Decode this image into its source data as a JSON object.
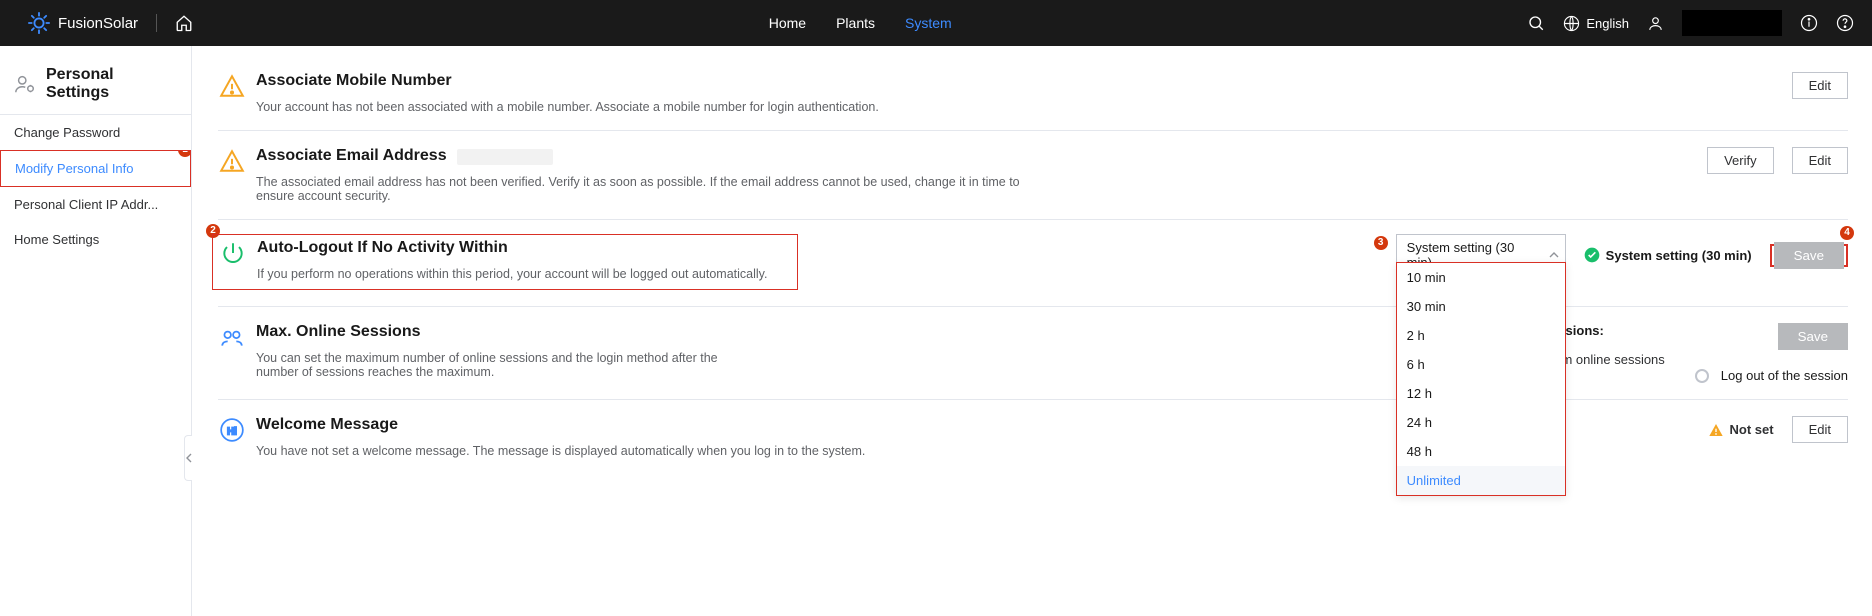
{
  "header": {
    "brand": "FusionSolar",
    "nav": {
      "home": "Home",
      "plants": "Plants",
      "system": "System"
    },
    "language": "English"
  },
  "sidebar": {
    "title": "Personal Settings",
    "items": [
      {
        "label": "Change Password"
      },
      {
        "label": "Modify Personal Info"
      },
      {
        "label": "Personal Client IP Addr..."
      },
      {
        "label": "Home Settings"
      }
    ]
  },
  "badges": {
    "b1": "1",
    "b2": "2",
    "b3": "3",
    "b4": "4"
  },
  "sections": {
    "mobile": {
      "title": "Associate Mobile Number",
      "desc": "Your account has not been associated with a mobile number. Associate a mobile number for login authentication.",
      "edit": "Edit"
    },
    "email": {
      "title": "Associate Email Address",
      "desc": "The associated email address has not been verified. Verify it as soon as possible. If the email address cannot be used, change it in time to ensure account security.",
      "verify": "Verify",
      "edit": "Edit"
    },
    "autologout": {
      "title": "Auto-Logout If No Activity Within",
      "desc": "If you perform no operations within this period, your account will be logged out automatically.",
      "selected": "System setting (30 min)",
      "status": "System setting (30 min)",
      "save": "Save",
      "options": [
        "10 min",
        "30 min",
        "2 h",
        "6 h",
        "12 h",
        "24 h",
        "48 h",
        "Unlimited"
      ]
    },
    "sessions": {
      "title": "Max. Online Sessions",
      "desc": "You can set the maximum number of online sessions and the login method after the number of sessions reaches the maximum.",
      "checkbox_label": "Max. online sessions:",
      "line2": "Login when maximum online sessions",
      "radio_label": "Log out of the session",
      "save": "Save"
    },
    "welcome": {
      "title": "Welcome Message",
      "desc": "You have not set a welcome message. The message is displayed automatically when you log in to the system.",
      "status": "Not set",
      "edit": "Edit"
    }
  }
}
